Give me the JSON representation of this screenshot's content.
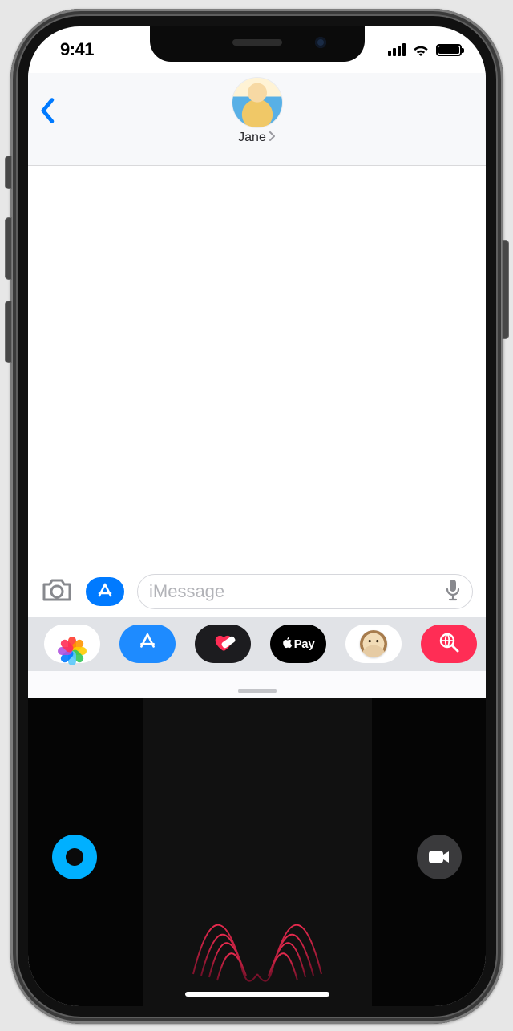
{
  "status_bar": {
    "time": "9:41"
  },
  "nav": {
    "contact_name": "Jane"
  },
  "input": {
    "placeholder": "iMessage"
  },
  "app_strip": {
    "apple_pay_label": "Pay",
    "items": [
      "photos",
      "store",
      "digital-touch",
      "apple-pay",
      "memoji",
      "find",
      "music"
    ]
  },
  "icons": {
    "back": "chevron-left",
    "camera": "camera",
    "appstore": "appstore",
    "mic": "microphone",
    "heart": "heart",
    "globe": "globe-search",
    "video": "video-camera"
  },
  "colors": {
    "ios_blue": "#007aff",
    "dt_color": "#00b0ff",
    "dt_accent": "#ff2d55",
    "icon_gray": "#88898e"
  }
}
